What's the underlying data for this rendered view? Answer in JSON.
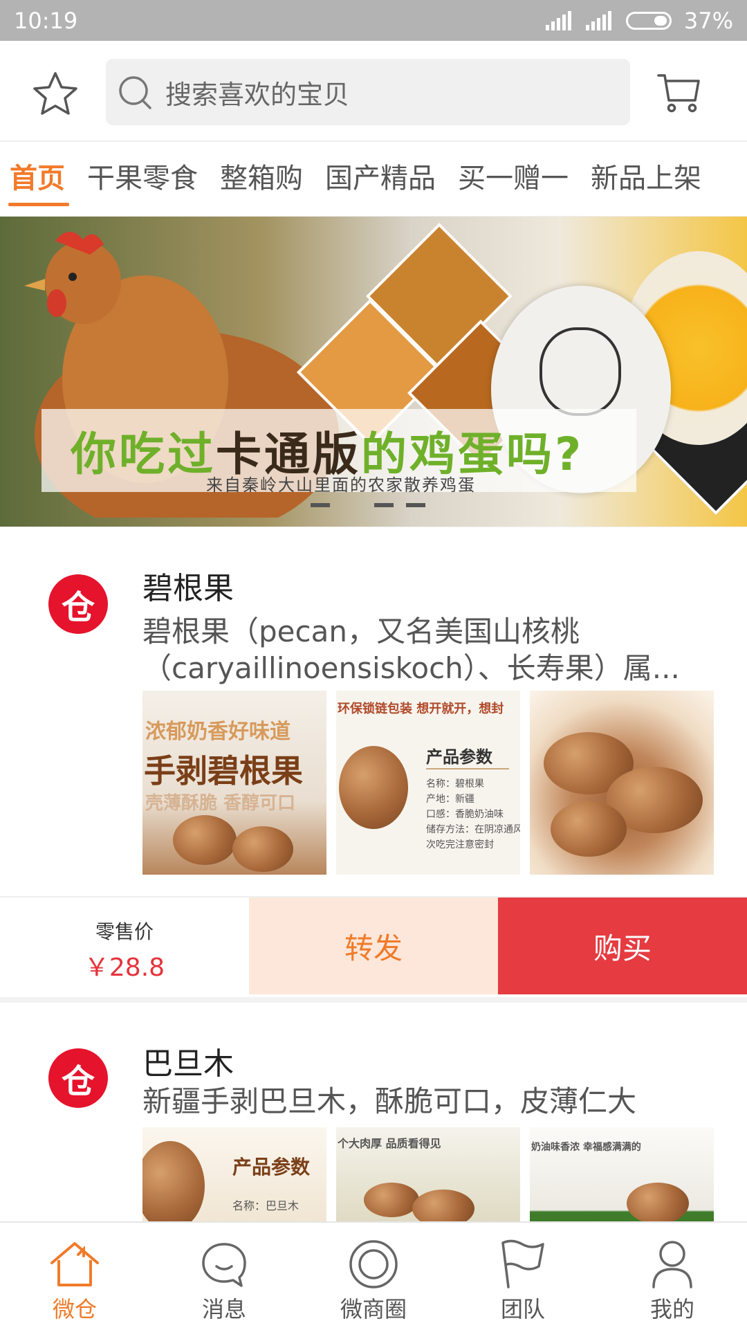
{
  "status_bar": {
    "time": "10:19",
    "battery": "37%"
  },
  "header": {
    "favorite_icon": "star-icon",
    "search_placeholder": "搜索喜欢的宝贝",
    "cart_icon": "cart-icon"
  },
  "tabs": [
    {
      "label": "首页",
      "active": true
    },
    {
      "label": "干果零食"
    },
    {
      "label": "整箱购"
    },
    {
      "label": "国产精品"
    },
    {
      "label": "买一赠一"
    },
    {
      "label": "新品上架"
    }
  ],
  "banner": {
    "title_green_1": "你吃过",
    "title_dark": "卡通版",
    "title_green_2": "的鸡蛋吗?",
    "subtitle": "来自秦岭大山里面的农家散养鸡蛋",
    "page_count": 4,
    "current_page": 2
  },
  "products": [
    {
      "name": "碧根果",
      "description": "碧根果（pecan，又名美国山核桃（caryaillinoensiskoch）、长寿果）属...",
      "store_logo_char": "仓",
      "thumb_texts": {
        "t1_line1": "浓郁奶香好味道",
        "t1_line2": "手剥碧根果",
        "t1_line3": "壳薄酥脆 香醇可口",
        "t2_banner": "环保锁链包装 想开就开，想封",
        "t2_title": "产品参数",
        "t2_lines": [
          "名称：碧根果",
          "产地：新疆",
          "口感：香脆奶油味",
          "储存方法：在阴凉通风",
          "次吃完注意密封"
        ]
      },
      "retail_label": "零售价",
      "price": "￥28.8",
      "share_label": "转发",
      "buy_label": "购买"
    },
    {
      "name": "巴旦木",
      "description": "新疆手剥巴旦木，酥脆可口，皮薄仁大",
      "store_logo_char": "仓",
      "thumb_texts": {
        "t4_title": "产品参数",
        "t4_line": "名称：巴旦木",
        "t5_banner": "个大肉厚 品质看得见",
        "t6_banner": "奶油味香浓 幸福感满满的"
      }
    }
  ],
  "bottom_nav": [
    {
      "label": "微仓",
      "icon": "home-icon",
      "active": true
    },
    {
      "label": "消息",
      "icon": "chat-icon"
    },
    {
      "label": "微商圈",
      "icon": "circle-icon"
    },
    {
      "label": "团队",
      "icon": "flag-icon"
    },
    {
      "label": "我的",
      "icon": "user-icon"
    }
  ],
  "colors": {
    "accent": "#f07b2a",
    "buy": "#e53b41",
    "share_bg": "#fde7da",
    "logo_red": "#e5132c"
  }
}
